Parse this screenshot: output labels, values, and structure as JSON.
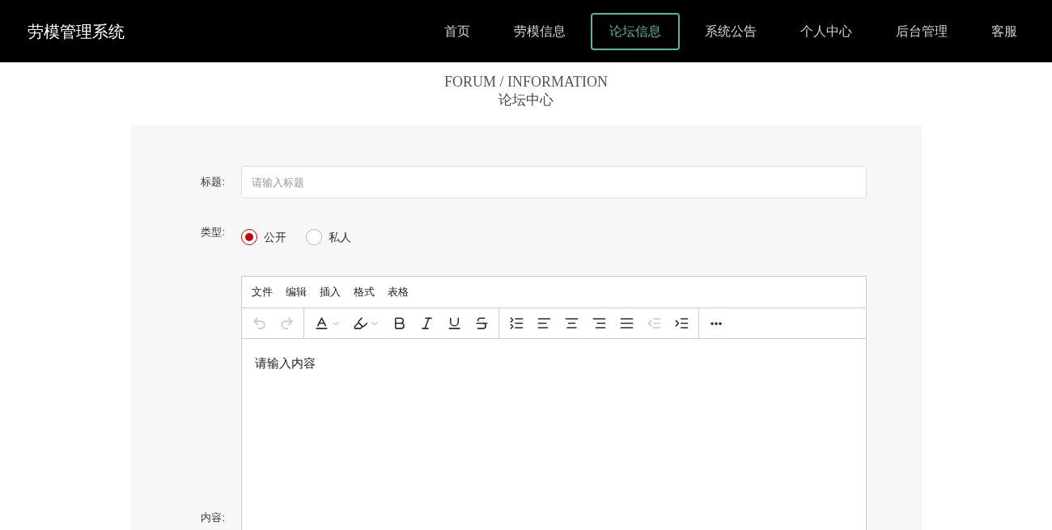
{
  "header": {
    "title": "劳模管理系统",
    "nav": [
      {
        "label": "首页",
        "selected": false
      },
      {
        "label": "劳模信息",
        "selected": false
      },
      {
        "label": "论坛信息",
        "selected": true
      },
      {
        "label": "系统公告",
        "selected": false
      },
      {
        "label": "个人中心",
        "selected": false
      },
      {
        "label": "后台管理",
        "selected": false
      },
      {
        "label": "客服",
        "selected": false
      }
    ]
  },
  "page_heading": {
    "subtitle": "FORUM / INFORMATION",
    "title": "论坛中心"
  },
  "form": {
    "title_field": {
      "label": "标题:",
      "placeholder": "请输入标题"
    },
    "type_field": {
      "label": "类型:",
      "options": [
        {
          "label": "公开",
          "selected": true
        },
        {
          "label": "私人",
          "selected": false
        }
      ]
    },
    "content_field": {
      "label": "内容:",
      "menu": [
        "文件",
        "编辑",
        "插入",
        "格式",
        "表格"
      ],
      "toolbar": [
        {
          "kind": "undo",
          "disabled": true
        },
        {
          "kind": "redo",
          "disabled": true
        },
        {
          "kind": "sep"
        },
        {
          "kind": "fontcolor",
          "disabled": false
        },
        {
          "kind": "highlight",
          "disabled": false
        },
        {
          "kind": "bold",
          "disabled": false
        },
        {
          "kind": "italic",
          "disabled": false
        },
        {
          "kind": "underline",
          "disabled": false
        },
        {
          "kind": "strike",
          "disabled": false
        },
        {
          "kind": "sep"
        },
        {
          "kind": "lineheight",
          "disabled": false
        },
        {
          "kind": "alignleft",
          "disabled": false
        },
        {
          "kind": "aligncenter",
          "disabled": false
        },
        {
          "kind": "alignright",
          "disabled": false
        },
        {
          "kind": "justify",
          "disabled": false
        },
        {
          "kind": "outdent",
          "disabled": true
        },
        {
          "kind": "indent",
          "disabled": false
        },
        {
          "kind": "sep"
        },
        {
          "kind": "more",
          "disabled": false
        }
      ],
      "placeholder": "请输入内容"
    }
  }
}
